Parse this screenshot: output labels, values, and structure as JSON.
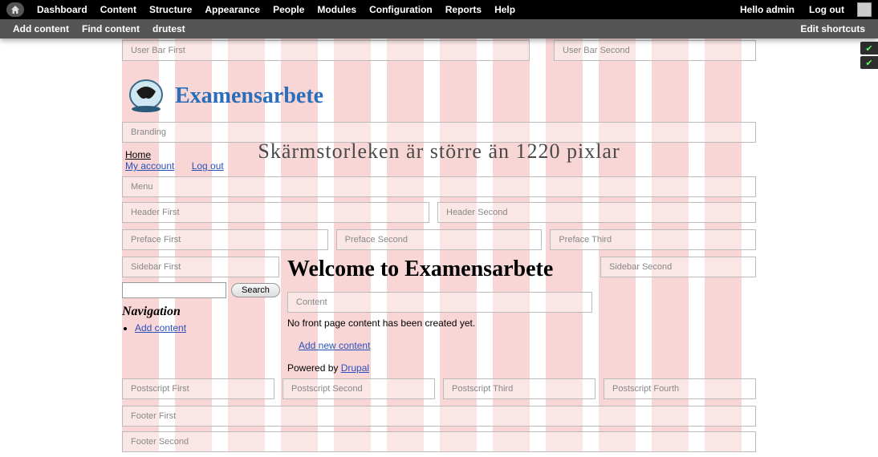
{
  "admin_menu": {
    "items": [
      "Dashboard",
      "Content",
      "Structure",
      "Appearance",
      "People",
      "Modules",
      "Configuration",
      "Reports",
      "Help"
    ],
    "hello": "Hello admin",
    "logout": "Log out"
  },
  "shortcuts": {
    "items": [
      "Add content",
      "Find content",
      "drutest"
    ],
    "edit": "Edit shortcuts"
  },
  "regions": {
    "user_bar_first": "User Bar First",
    "user_bar_second": "User Bar Second",
    "branding": "Branding",
    "menu": "Menu",
    "header_first": "Header First",
    "header_second": "Header Second",
    "preface_first": "Preface First",
    "preface_second": "Preface Second",
    "preface_third": "Preface Third",
    "sidebar_first": "Sidebar First",
    "sidebar_second": "Sidebar Second",
    "content": "Content",
    "postscript_first": "Postscript First",
    "postscript_second": "Postscript Second",
    "postscript_third": "Postscript Third",
    "postscript_fourth": "Postscript Fourth",
    "footer_first": "Footer First",
    "footer_second": "Footer Second"
  },
  "site_name": "Examensarbete",
  "nav": {
    "home": "Home",
    "my_account": "My account",
    "logout": "Log out"
  },
  "screensize_text": "Skärmstorleken är större än 1220 pixlar",
  "page_title": "Welcome to Examensarbete",
  "search": {
    "button": "Search"
  },
  "navigation": {
    "heading": "Navigation",
    "add_content": "Add content"
  },
  "front": {
    "empty": "No front page content has been created yet.",
    "add_new": "Add new content",
    "powered": "Powered by ",
    "drupal": "Drupal"
  }
}
